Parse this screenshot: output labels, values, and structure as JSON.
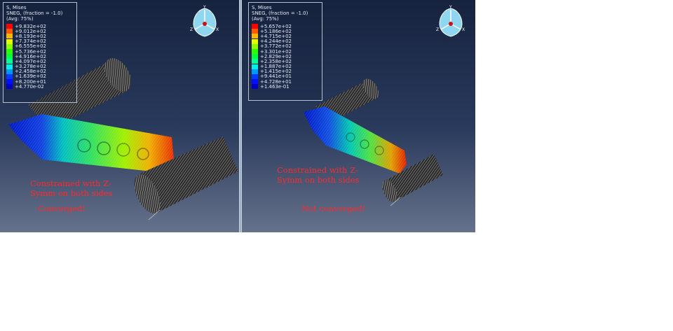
{
  "left": {
    "legend_title": "S, Mises",
    "legend_sub": "SNEG, (fraction = -1.0)",
    "legend_avg": "(Avg: 75%)",
    "values": [
      "+9.832e+02",
      "+9.012e+02",
      "+8.193e+02",
      "+7.374e+02",
      "+6.555e+02",
      "+5.736e+02",
      "+4.916e+02",
      "+4.097e+02",
      "+3.278e+02",
      "+2.458e+02",
      "+1.639e+02",
      "+8.200e+01",
      "+4.770e-02"
    ],
    "annotation_line1": "Constrained with Z-",
    "annotation_line2": "Symm on both sides",
    "status": "Converged!"
  },
  "right": {
    "legend_title": "S, Mises",
    "legend_sub": "SNEG, (fraction = -1.0)",
    "legend_avg": "(Avg: 75%)",
    "values": [
      "+5.657e+02",
      "+5.186e+02",
      "+4.715e+02",
      "+4.244e+02",
      "+3.772e+02",
      "+3.301e+02",
      "+2.829e+02",
      "+2.358e+02",
      "+1.887e+02",
      "+1.415e+02",
      "+9.441e+01",
      "+4.728e+01",
      "+1.463e-01"
    ],
    "annotation_line1": "Constrained with Z-",
    "annotation_line2": "Symm on both sides",
    "status": "Not converged!"
  },
  "triad_labels": {
    "y": "Y",
    "z": "Z",
    "x": "X"
  },
  "colors": {
    "annotation": "#ff2a2a",
    "scale": [
      "#ff0000",
      "#ff5a00",
      "#ffb400",
      "#e6ff00",
      "#8cff00",
      "#2dff00",
      "#00ff3c",
      "#00ff96",
      "#00f0e6",
      "#0096ff",
      "#003cff",
      "#0010ff",
      "#0000c8"
    ]
  }
}
